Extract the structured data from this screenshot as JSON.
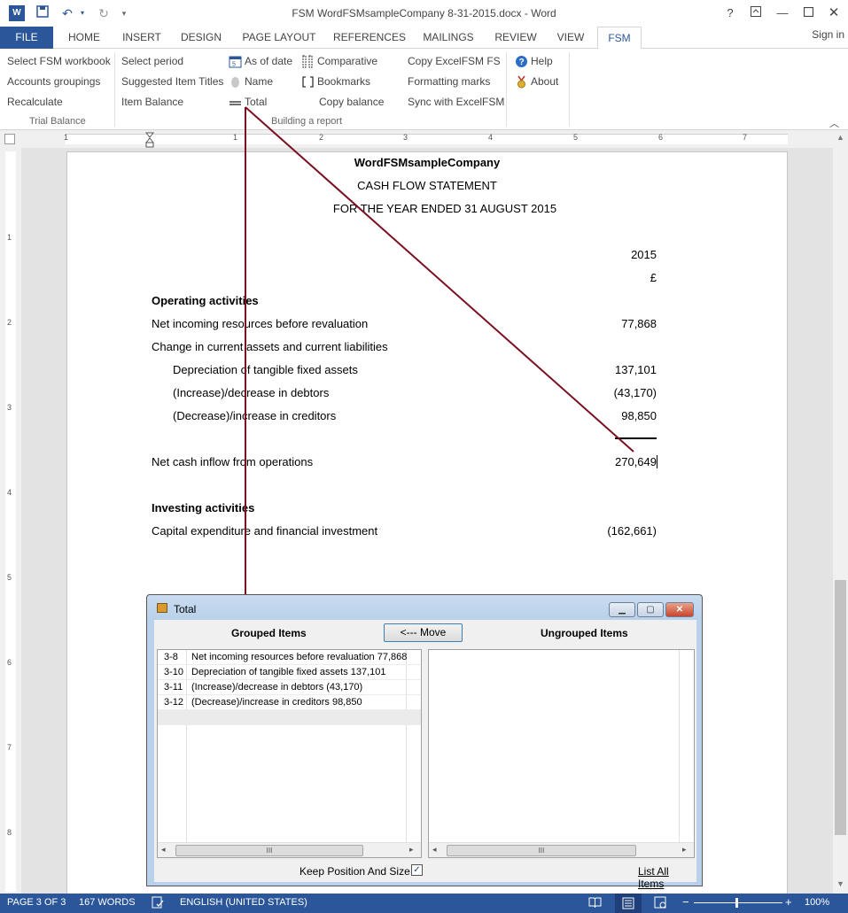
{
  "titlebar": {
    "app_icon": "W",
    "doc_title": "FSM WordFSMsampleCompany 8-31-2015.docx - Word",
    "help": "?",
    "qa_icons": [
      "save-icon",
      "undo-icon",
      "redo-icon",
      "customize-icon"
    ],
    "window_buttons": [
      "ribbon-display-options-icon",
      "minimize-icon",
      "maximize-icon",
      "close-icon"
    ]
  },
  "tabs": [
    "FILE",
    "HOME",
    "INSERT",
    "DESIGN",
    "PAGE LAYOUT",
    "REFERENCES",
    "MAILINGS",
    "REVIEW",
    "VIEW",
    "FSM"
  ],
  "active_tab": "FSM",
  "signin": "Sign in",
  "ribbon": {
    "trial_balance": {
      "items": [
        "Select FSM workbook",
        "Accounts groupings",
        "Recalculate"
      ],
      "label": "Trial Balance"
    },
    "building_report": {
      "col1": [
        "Select period",
        "Suggested Item Titles",
        "Item Balance"
      ],
      "col2": [
        "As of date",
        "Name",
        "Total"
      ],
      "col3": [
        "Comparative",
        "Bookmarks",
        "Copy balance"
      ],
      "col4": [
        "Copy ExcelFSM FS",
        "Formatting marks",
        "Sync with ExcelFSM"
      ],
      "label": "Building a report"
    },
    "help": [
      "Help",
      "About"
    ]
  },
  "ruler": {
    "h_numbers": [
      "1",
      "1",
      "2",
      "3",
      "4",
      "5",
      "6",
      "7"
    ],
    "v_numbers": [
      "1",
      "2",
      "3",
      "4",
      "5",
      "6",
      "7",
      "8"
    ]
  },
  "document": {
    "company": "WordFSMsampleCompany",
    "statement": "CASH FLOW STATEMENT",
    "period": "FOR THE YEAR ENDED 31 AUGUST 2015",
    "year": "2015",
    "currency": "£",
    "operating_heading": "Operating activities",
    "net_incoming_label": "Net incoming resources before revaluation",
    "net_incoming_value": "77,868",
    "change_label": "Change in current assets and current liabilities",
    "depreciation_label": "Depreciation of tangible fixed assets",
    "depreciation_value": "137,101",
    "debtors_label": "(Increase)/decrease in debtors",
    "debtors_value": "(43,170)",
    "creditors_label": "(Decrease)/increase in creditors",
    "creditors_value": "98,850",
    "net_cash_label": "Net cash inflow from operations",
    "net_cash_value": "270,649",
    "investing_heading": "Investing activities",
    "capex_label": "Capital expenditure and financial investment",
    "capex_value": "(162,661)"
  },
  "dialog": {
    "title": "Total",
    "grouped_header": "Grouped Items",
    "ungrouped_header": "Ungrouped Items",
    "move_button": "<--- Move",
    "grouped_rows": [
      {
        "code": "3-8",
        "text": "Net incoming resources before revaluation 77,868"
      },
      {
        "code": "3-10",
        "text": "Depreciation of tangible fixed assets 137,101"
      },
      {
        "code": "3-11",
        "text": "(Increase)/decrease in debtors (43,170)"
      },
      {
        "code": "3-12",
        "text": "(Decrease)/increase in creditors 98,850"
      }
    ],
    "scroll_grip": "III",
    "keep_position": "Keep Position And Size",
    "keep_checked": "✓",
    "list_all": "List All Items"
  },
  "statusbar": {
    "page": "PAGE 3 OF 3",
    "words": "167 WORDS",
    "language": "ENGLISH (UNITED STATES)",
    "zoom": "100%",
    "zoom_minus": "−",
    "zoom_plus": "+"
  },
  "colors": {
    "accent": "#2b579a",
    "callout_line": "#7a0f1f"
  }
}
